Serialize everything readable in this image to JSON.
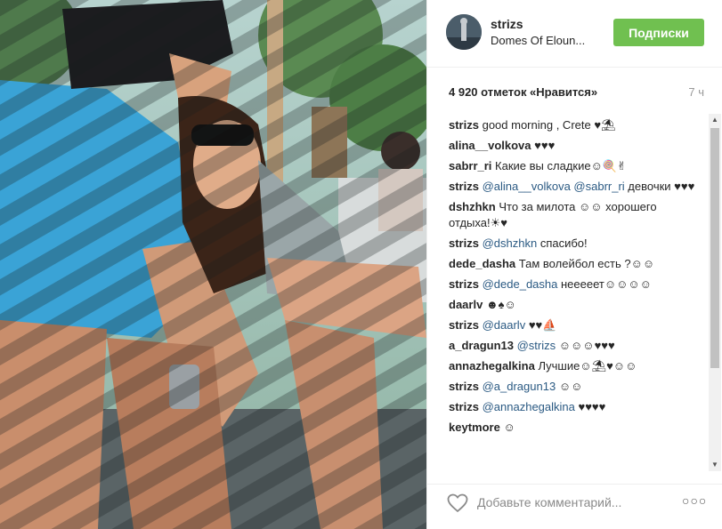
{
  "post": {
    "username": "strizs",
    "location": "Domes Of Eloun...",
    "follow_label": "Подписки",
    "likes": "4 920 отметок «Нравится»",
    "time": "7 ч"
  },
  "comments": [
    {
      "author": "strizs",
      "parts": [
        {
          "text": "good morning , Crete ♥⛱",
          "mention": false
        }
      ]
    },
    {
      "author": "alina__volkova",
      "parts": [
        {
          "text": "♥♥♥",
          "mention": false
        }
      ]
    },
    {
      "author": "sabrr_ri",
      "parts": [
        {
          "text": "Какие вы сладкие☺🍭✌",
          "mention": false
        }
      ]
    },
    {
      "author": "strizs",
      "parts": [
        {
          "text": "@alina__volkova",
          "mention": true
        },
        {
          "text": " ",
          "mention": false
        },
        {
          "text": "@sabrr_ri",
          "mention": true
        },
        {
          "text": " девочки ♥♥♥",
          "mention": false
        }
      ]
    },
    {
      "author": "dshzhkn",
      "parts": [
        {
          "text": "Что за милота ☺☺ хорошего отдыха!☀♥",
          "mention": false
        }
      ]
    },
    {
      "author": "strizs",
      "parts": [
        {
          "text": "@dshzhkn",
          "mention": true
        },
        {
          "text": " спасибо!",
          "mention": false
        }
      ]
    },
    {
      "author": "dede_dasha",
      "parts": [
        {
          "text": "Там волейбол есть ?☺☺",
          "mention": false
        }
      ]
    },
    {
      "author": "strizs",
      "parts": [
        {
          "text": "@dede_dasha",
          "mention": true
        },
        {
          "text": " нееееет☺☺☺☺",
          "mention": false
        }
      ]
    },
    {
      "author": "daarlv",
      "parts": [
        {
          "text": "☻♠☺",
          "mention": false
        }
      ]
    },
    {
      "author": "strizs",
      "parts": [
        {
          "text": "@daarlv",
          "mention": true
        },
        {
          "text": " ♥♥⛵",
          "mention": false
        }
      ]
    },
    {
      "author": "a_dragun13",
      "parts": [
        {
          "text": "@strizs",
          "mention": true
        },
        {
          "text": " ☺☺☺♥♥♥",
          "mention": false
        }
      ]
    },
    {
      "author": "annazhegalkina",
      "parts": [
        {
          "text": "Лучшие☺⛱♥☺☺",
          "mention": false
        }
      ]
    },
    {
      "author": "strizs",
      "parts": [
        {
          "text": "@a_dragun13",
          "mention": true
        },
        {
          "text": " ☺☺",
          "mention": false
        }
      ]
    },
    {
      "author": "strizs",
      "parts": [
        {
          "text": "@annazhegalkina",
          "mention": true
        },
        {
          "text": " ♥♥♥♥",
          "mention": false
        }
      ]
    },
    {
      "author": "keytmore",
      "parts": [
        {
          "text": "☺",
          "mention": false
        }
      ]
    }
  ],
  "footer": {
    "comment_placeholder": "Добавьте комментарий...",
    "more_label": "○○○"
  },
  "colors": {
    "follow_button": "#70c050",
    "mention": "#2b5a83",
    "border": "#efefef"
  },
  "icons": {
    "like": "heart-icon",
    "more": "more-options-icon",
    "scroll_up": "arrow-up-icon",
    "scroll_down": "arrow-down-icon"
  }
}
